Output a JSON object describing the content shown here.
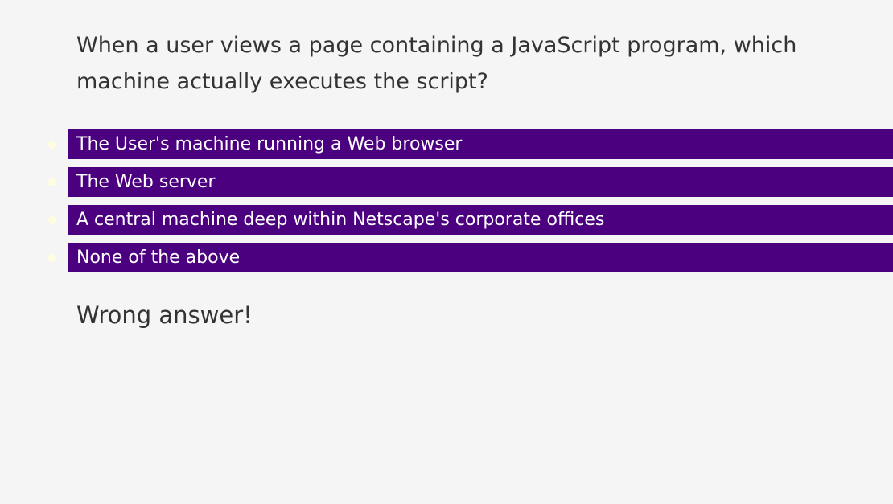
{
  "quiz": {
    "question": "When a user views a page containing a JavaScript program, which machine actually executes the script?",
    "answers": [
      {
        "label": "The User's machine running a Web browser"
      },
      {
        "label": "The Web server"
      },
      {
        "label": "A central machine deep within Netscape's corporate offices"
      },
      {
        "label": "None of the above"
      }
    ],
    "result": "Wrong answer!"
  },
  "colors": {
    "background": "#f5f5f5",
    "answer_background": "#4b0080",
    "answer_text": "#ffffff",
    "bullet": "#fffde0",
    "text": "#333333"
  }
}
